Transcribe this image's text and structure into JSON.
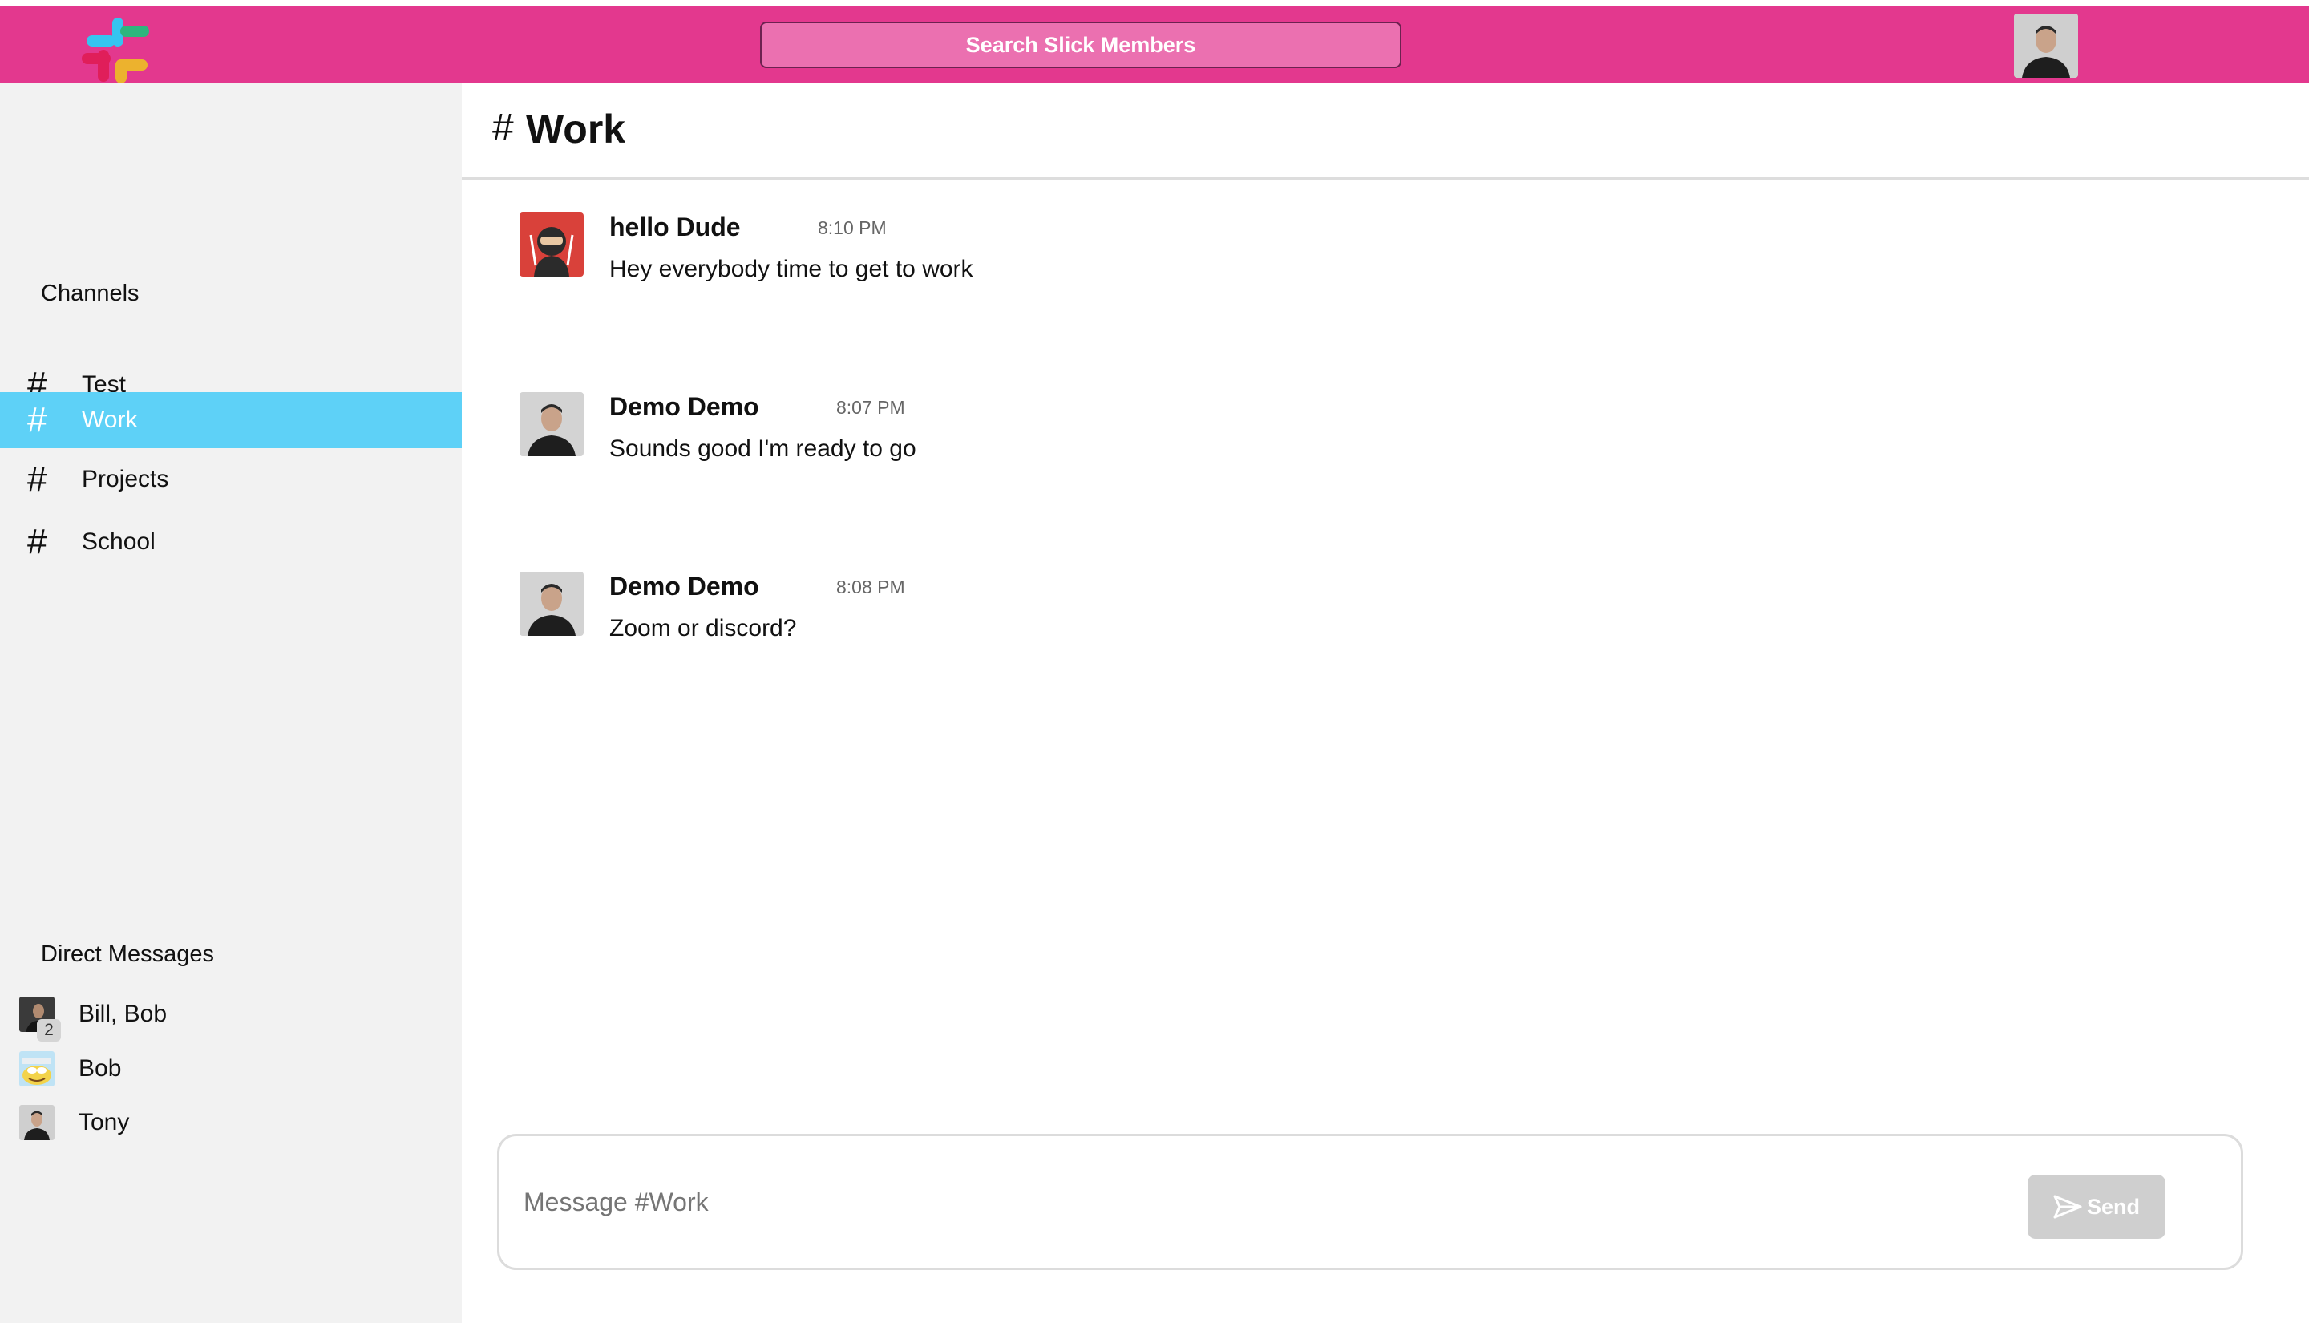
{
  "header": {
    "search_label": "Search Slick Members"
  },
  "sidebar": {
    "channels_title": "Channels",
    "channels": [
      {
        "label": "Test",
        "active": false
      },
      {
        "label": "Work",
        "active": true
      },
      {
        "label": "Projects",
        "active": false
      },
      {
        "label": "School",
        "active": false
      }
    ],
    "dm_title": "Direct Messages",
    "dms": [
      {
        "label": "Bill, Bob",
        "badge": "2"
      },
      {
        "label": "Bob"
      },
      {
        "label": "Tony"
      }
    ]
  },
  "channel": {
    "hash": "#",
    "name": "Work"
  },
  "messages": [
    {
      "author": "hello Dude",
      "time": "8:10 PM",
      "text": "Hey everybody time to get to work"
    },
    {
      "author": "Demo Demo",
      "time": "8:07 PM",
      "text": "Sounds good I'm ready to go"
    },
    {
      "author": "Demo Demo",
      "time": "8:08 PM",
      "text": "Zoom or discord?"
    }
  ],
  "composer": {
    "placeholder": "Message #Work",
    "send_label": "Send"
  },
  "colors": {
    "header": "#e3388e",
    "active_channel": "#5ed1f7",
    "sidebar_bg": "#f2f2f2",
    "send_disabled": "#cfcfcf"
  }
}
